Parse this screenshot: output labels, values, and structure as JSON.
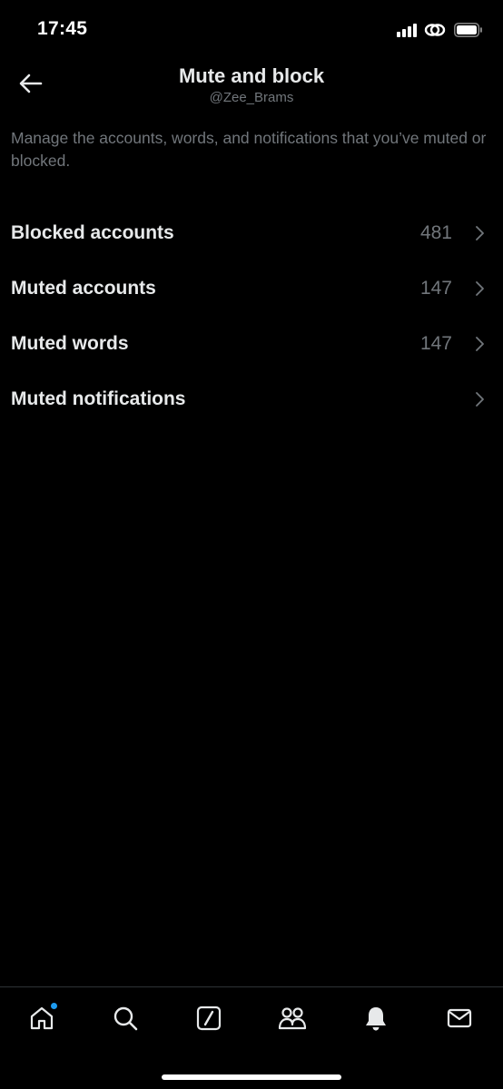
{
  "status_bar": {
    "time": "17:45",
    "icons": [
      "cellular-signal-icon",
      "link-icon",
      "battery-icon"
    ]
  },
  "header": {
    "back_icon": "arrow-left-icon",
    "title": "Mute and block",
    "subtitle": "@Zee_Brams"
  },
  "description": "Manage the accounts, words, and notifications that you’ve muted or blocked.",
  "menu": {
    "items": [
      {
        "label": "Blocked accounts",
        "count": "481"
      },
      {
        "label": "Muted accounts",
        "count": "147"
      },
      {
        "label": "Muted words",
        "count": "147"
      },
      {
        "label": "Muted notifications",
        "count": ""
      }
    ]
  },
  "bottom_nav": {
    "items": [
      "home-icon",
      "search-icon",
      "grok-icon",
      "communities-icon",
      "notifications-icon",
      "messages-icon"
    ],
    "active": "notifications-icon",
    "home_badge": true
  },
  "colors": {
    "background": "#000000",
    "primary_text": "#e7e9ea",
    "secondary_text": "#71767b",
    "accent": "#1d9bf0",
    "divider": "#2f3336"
  }
}
